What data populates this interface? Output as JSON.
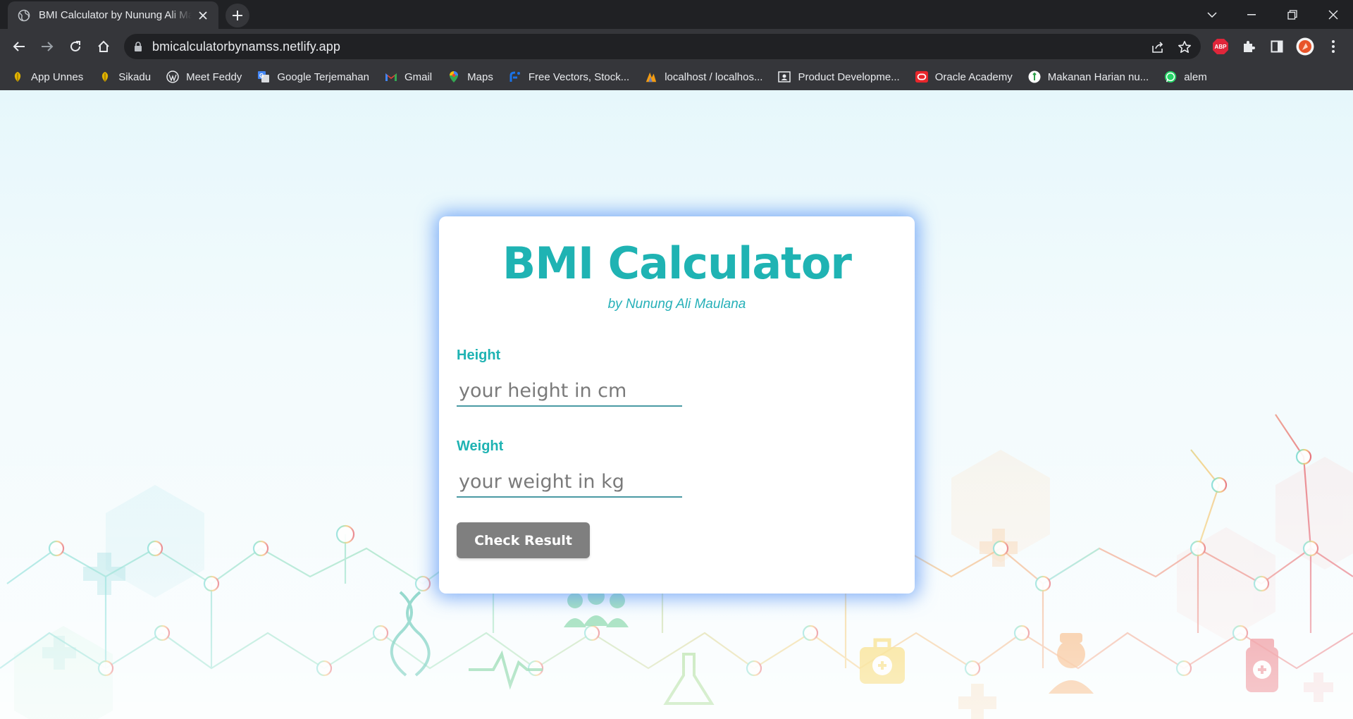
{
  "browser": {
    "tab_title": "BMI Calculator by Nunung Ali Maulana",
    "url": "bmicalculatorbynamss.netlify.app",
    "bookmarks": [
      {
        "label": "App Unnes"
      },
      {
        "label": "Sikadu"
      },
      {
        "label": "Meet Feddy"
      },
      {
        "label": "Google Terjemahan"
      },
      {
        "label": "Gmail"
      },
      {
        "label": "Maps"
      },
      {
        "label": "Free Vectors, Stock..."
      },
      {
        "label": "localhost / localhos..."
      },
      {
        "label": "Product Developme..."
      },
      {
        "label": "Oracle Academy"
      },
      {
        "label": "Makanan Harian nu..."
      },
      {
        "label": "alem"
      }
    ],
    "extension_abp_label": "ABP",
    "accent_color": "#202124"
  },
  "card": {
    "title": "BMI Calculator",
    "subtitle": "by Nunung Ali Maulana",
    "height_label": "Height",
    "height_placeholder": "your height in cm",
    "height_value": "",
    "weight_label": "Weight",
    "weight_placeholder": "your weight in kg",
    "weight_value": "",
    "button_label": "Check Result",
    "title_color": "#1fb3b3",
    "button_color": "#7f7f7f"
  }
}
